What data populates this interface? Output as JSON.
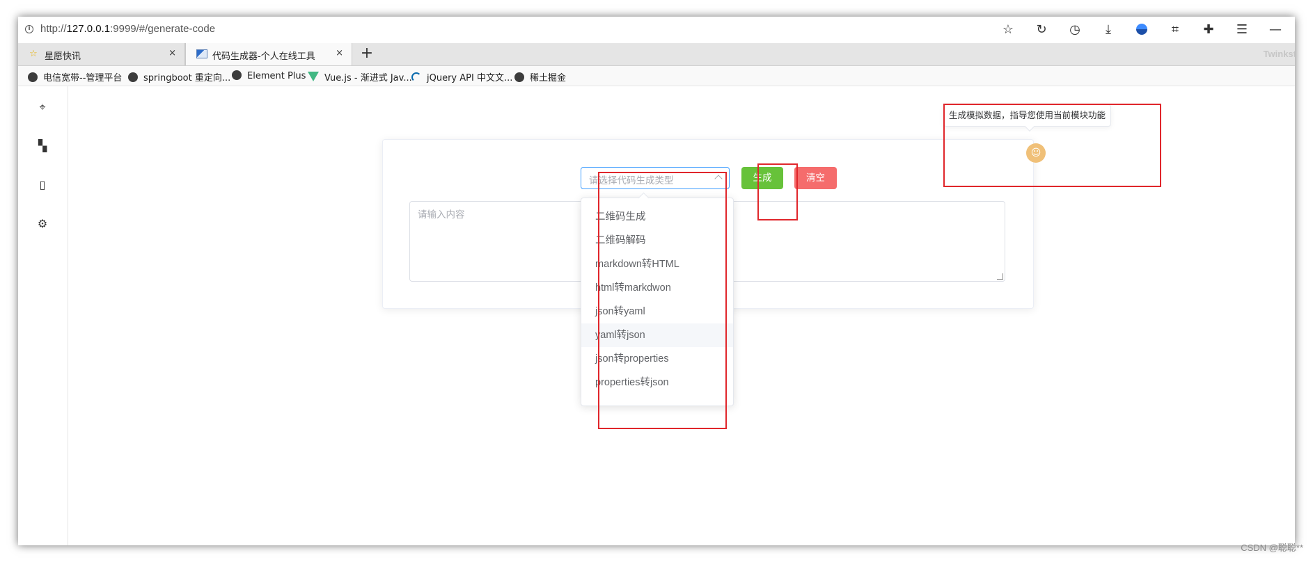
{
  "browser": {
    "url_prefix": "http://",
    "url_host": "127.0.0.1",
    "url_rest": ":9999/#/generate-code",
    "toolbar_icons": [
      "star-icon",
      "reload-icon",
      "history-icon",
      "download-icon",
      "account-icon",
      "crop-icon",
      "extensions-icon",
      "menu-icon",
      "minimize-icon"
    ],
    "tabs": [
      {
        "label": "星愿快讯",
        "close": "×",
        "favicon": "star-icon"
      },
      {
        "label": "代码生成器-个人在线工具",
        "close": "×",
        "favicon": "site-icon"
      }
    ],
    "new_tab": "+",
    "tabbar_right_text": "Twinkst",
    "bookmarks": [
      {
        "label": "电信宽带--管理平台",
        "icon": "globe-icon"
      },
      {
        "label": "springboot 重定向...",
        "icon": "globe-icon"
      },
      {
        "label": "Element Plus",
        "icon": "globe-icon"
      },
      {
        "label": "Vue.js - 渐进式 Jav...",
        "icon": "vue-icon"
      },
      {
        "label": "jQuery API 中文文...",
        "icon": "jquery-icon"
      },
      {
        "label": "稀土掘金",
        "icon": "globe-icon"
      }
    ]
  },
  "sidebar": {
    "items": [
      {
        "icon": "location-icon"
      },
      {
        "icon": "grid-icon"
      },
      {
        "icon": "notebook-icon"
      },
      {
        "icon": "settings-icon"
      }
    ]
  },
  "tool": {
    "select_placeholder": "请选择代码生成类型",
    "generate_label": "生成",
    "clear_label": "清空",
    "textarea_placeholder": "请输入内容",
    "options": [
      "二维码生成",
      "二维码解码",
      "markdown转HTML",
      "html转markdwon",
      "json转yaml",
      "yaml转json",
      "json转properties",
      "properties转json"
    ],
    "hovered_option": "yaml转json",
    "tooltip": "生成模拟数据，指导您使用当前模块功能",
    "helper_icon": "robot-icon"
  },
  "colors": {
    "primary": "#409eff",
    "success": "#67c23a",
    "danger": "#f56c6c",
    "annotation": "#e0262b",
    "helper": "#f0c078"
  },
  "watermark": "CSDN @聪聪**"
}
